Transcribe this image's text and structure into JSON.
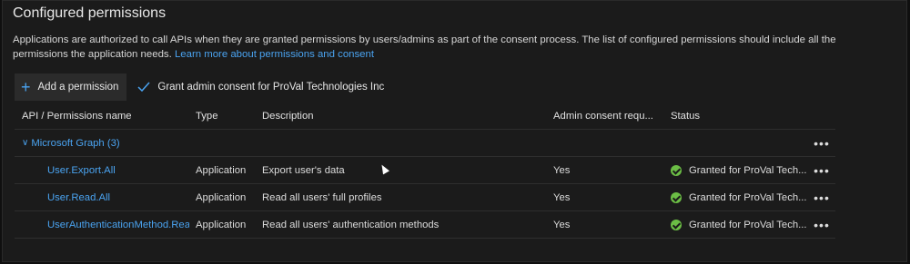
{
  "section": {
    "title": "Configured permissions",
    "description": "Applications are authorized to call APIs when they are granted permissions by users/admins as part of the consent process. The list of configured permissions should include all the permissions the application needs.",
    "learn_more": "Learn more about permissions and consent"
  },
  "toolbar": {
    "add_label": "Add a permission",
    "grant_label": "Grant admin consent for ProVal Technologies Inc"
  },
  "table": {
    "headers": [
      "API / Permissions name",
      "Type",
      "Description",
      "Admin consent requ...",
      "Status"
    ],
    "group": {
      "label": "Microsoft Graph (3)"
    },
    "rows": [
      {
        "name": "User.Export.All",
        "type": "Application",
        "description": "Export user's data",
        "admin": "Yes",
        "status": "Granted for ProVal Tech..."
      },
      {
        "name": "User.Read.All",
        "type": "Application",
        "description": "Read all users' full profiles",
        "admin": "Yes",
        "status": "Granted for ProVal Tech..."
      },
      {
        "name": "UserAuthenticationMethod.Read",
        "type": "Application",
        "description": "Read all users' authentication methods",
        "admin": "Yes",
        "status": "Granted for ProVal Tech..."
      }
    ]
  },
  "icons": {
    "add": "plus-icon",
    "grant": "checkmark-icon",
    "group_toggle": "chevron-down-icon",
    "status": "success-check-icon",
    "more": "ellipsis-icon"
  },
  "colors": {
    "accent": "#4aa3f0",
    "success": "#6bbd45",
    "background": "#1b1b1b"
  }
}
